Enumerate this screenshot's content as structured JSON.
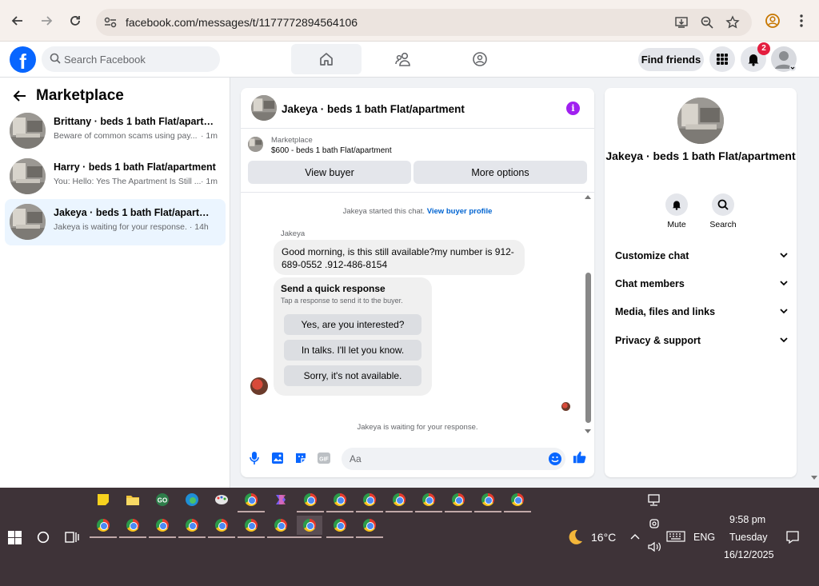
{
  "browser": {
    "url": "facebook.com/messages/t/1177772894564106"
  },
  "header": {
    "search_placeholder": "Search Facebook",
    "find_friends": "Find friends",
    "notification_count": "2"
  },
  "sidebar": {
    "title": "Marketplace",
    "conversations": [
      {
        "name": "Brittany · beds 1 bath Flat/apartme...",
        "snippet": "Beware of common scams using pay...",
        "time": "· 1m"
      },
      {
        "name": "Harry · beds 1 bath Flat/apartment",
        "snippet": "You: Hello: Yes The Apartment Is Still ...",
        "time": "· 1m"
      },
      {
        "name": "Jakeya · beds 1 bath Flat/apartment",
        "snippet": "Jakeya is waiting for your response. · 14h",
        "time": ""
      }
    ]
  },
  "chat": {
    "title": "Jakeya · beds 1 bath Flat/apartment",
    "listing_category": "Marketplace",
    "listing_price": "$600 - beds 1 bath Flat/apartment",
    "view_buyer": "View buyer",
    "more_options": "More options",
    "started_text": "Jakeya started this chat.",
    "view_profile_link": "View buyer profile",
    "sender": "Jakeya",
    "message": "Good morning, is this still available?my number is 912-689-0552 .912-486-8154",
    "quick_title": "Send a quick response",
    "quick_sub": "Tap a response to send it to the buyer.",
    "quick_responses": [
      "Yes, are you interested?",
      "In talks. I'll let you know.",
      "Sorry, it's not available."
    ],
    "waiting_text": "Jakeya is waiting for your response.",
    "composer_placeholder": "Aa"
  },
  "details": {
    "name": "Jakeya · beds 1 bath Flat/apartment",
    "mute": "Mute",
    "search": "Search",
    "sections": [
      "Customize chat",
      "Chat members",
      "Media, files and links",
      "Privacy & support"
    ]
  },
  "taskbar": {
    "temperature": "16°C",
    "language": "ENG",
    "time": "9:58 pm",
    "day": "Tuesday",
    "date": "16/12/2025"
  },
  "colors": {
    "fb_blue": "#0866ff",
    "link_blue": "#0064d1",
    "info_purple": "#a020f0",
    "badge_red": "#e41e3f"
  }
}
